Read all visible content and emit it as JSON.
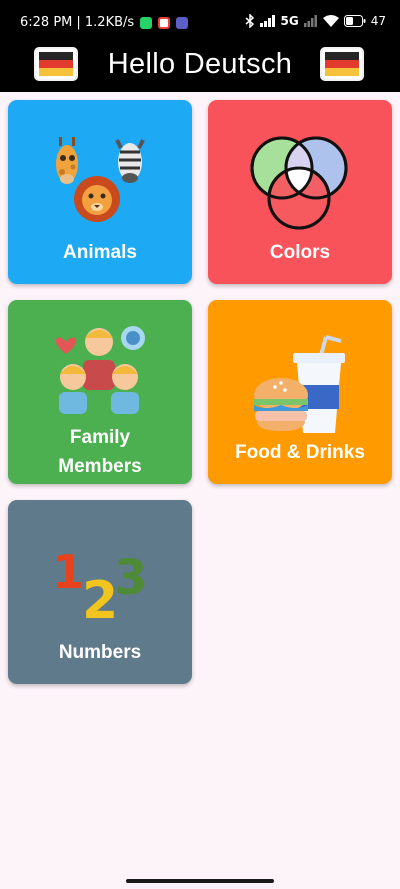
{
  "status_bar": {
    "time": "6:28 PM",
    "speed": "| 1.2KB/s",
    "network": "5G",
    "battery": "47"
  },
  "app_bar": {
    "title": "Hello Deutsch",
    "flag_colors": [
      "#262626",
      "#e23b2e",
      "#f7c23b"
    ]
  },
  "categories": [
    {
      "label": "Animals",
      "color": "#1ea9f4",
      "icon": "animals-icon"
    },
    {
      "label": "Colors",
      "color": "#f8525a",
      "icon": "color-circles-icon"
    },
    {
      "label": "Family\nMembers",
      "label_line1": "Family",
      "label_line2": "Members",
      "color": "#4caf50",
      "icon": "family-icon"
    },
    {
      "label": "Food & Drinks",
      "color": "#ff9a00",
      "icon": "burger-drink-icon"
    },
    {
      "label": "Numbers",
      "color": "#5f7a8a",
      "icon": "numbers-123-icon"
    }
  ]
}
